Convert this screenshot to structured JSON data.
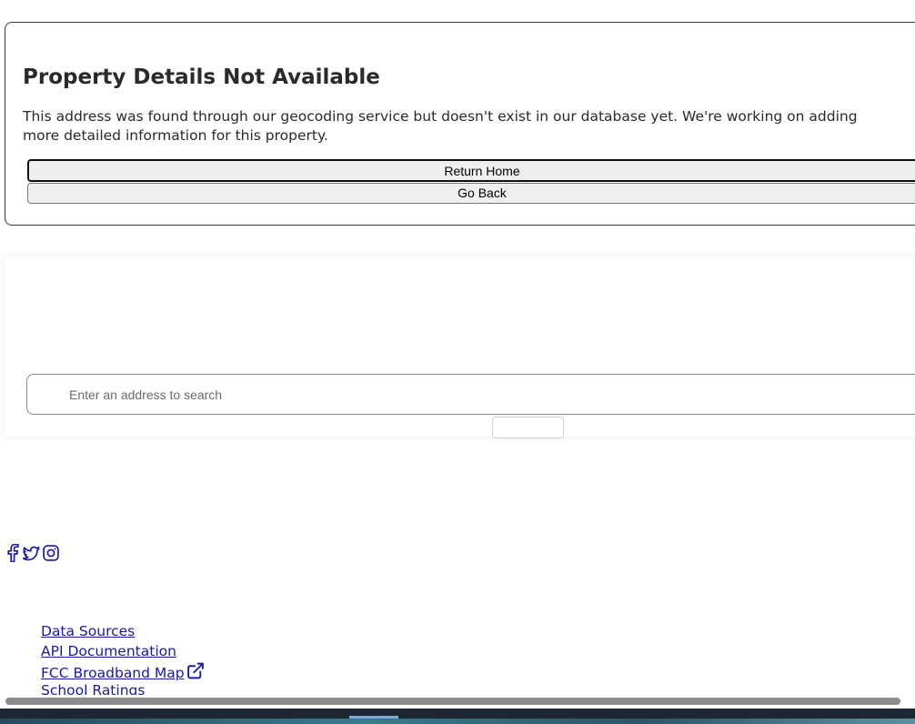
{
  "error": {
    "title": "Property Details Not Available",
    "message": "This address was found through our geocoding service but doesn't exist in our database yet. We're working on adding more detailed information for this property.",
    "return_home_label": "Return Home",
    "go_back_label": "Go Back"
  },
  "search": {
    "placeholder": "Enter an address to search",
    "value": "",
    "submit_label": ""
  },
  "social": {
    "icons": [
      "facebook-icon",
      "twitter-icon",
      "instagram-icon"
    ],
    "color": "#1a1aa6"
  },
  "footer": {
    "links": [
      {
        "label": "Data Sources"
      },
      {
        "label": "API Documentation"
      },
      {
        "label": "FCC Broadband Map",
        "external": true
      },
      {
        "label": "School Ratings"
      }
    ]
  },
  "colors": {
    "link": "#1a1aa6",
    "button_bg": "#efefef",
    "card_border": "#3a3a3a"
  }
}
